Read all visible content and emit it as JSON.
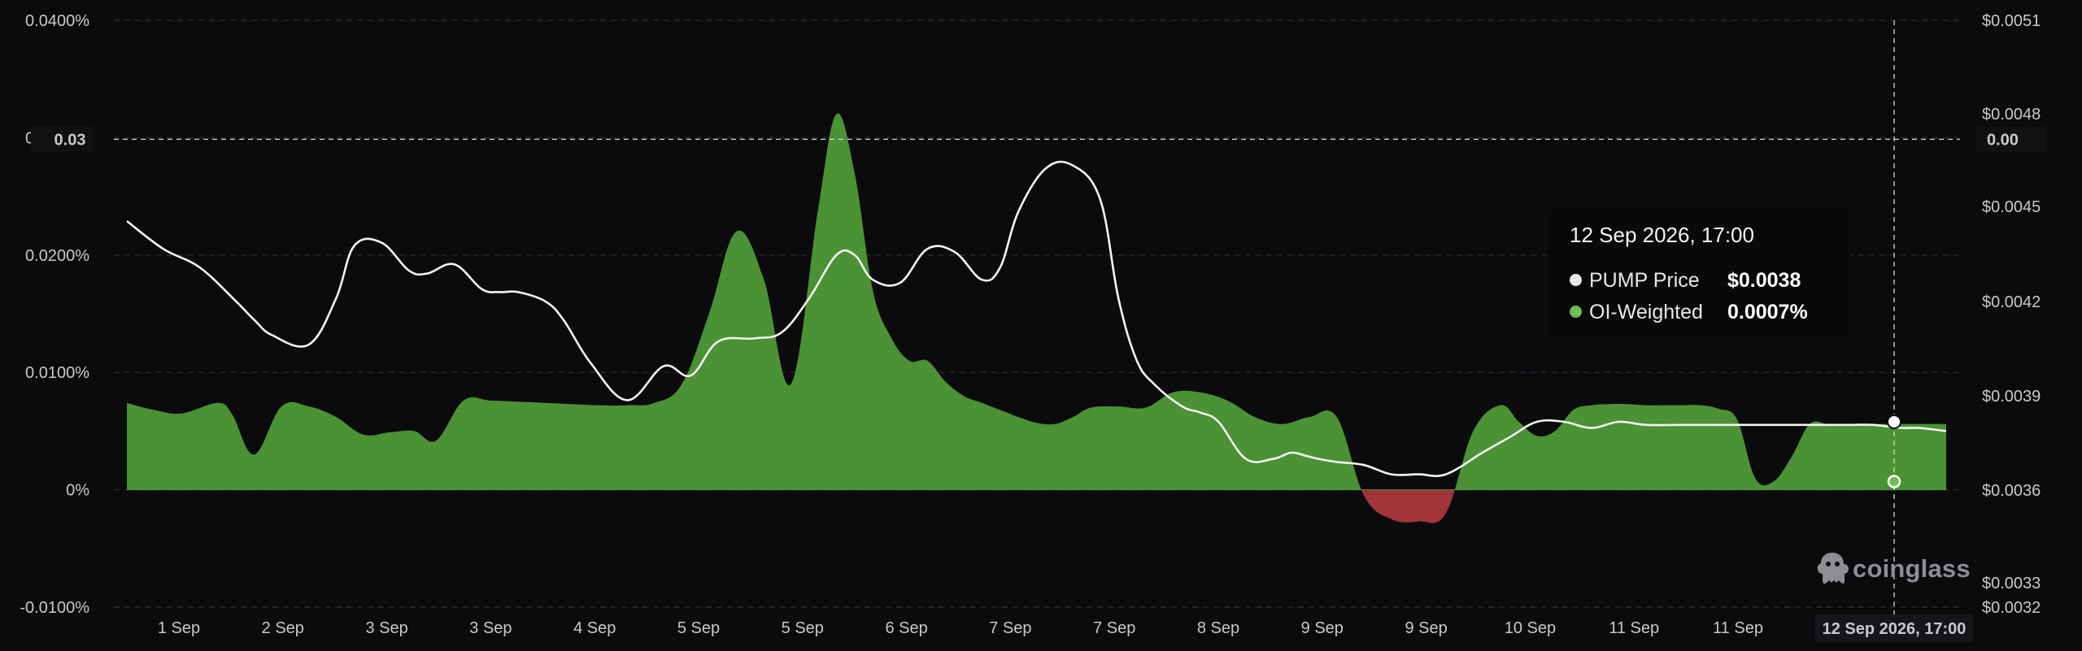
{
  "chart_data": {
    "type": "area",
    "y_left": {
      "range": [
        -0.0001,
        0.0004
      ],
      "ticks": [
        "-0.0100%",
        "0%",
        "0.0100%",
        "0.0200%",
        "0.0300%",
        "0.0400%"
      ],
      "crosshair_label": "0.03"
    },
    "y_right": {
      "range": [
        0.0032,
        0.0051
      ],
      "ticks": [
        "$0.0032",
        "$0.0033",
        "$0.0036",
        "$0.0039",
        "$0.0042",
        "$0.0045",
        "$0.0048",
        "$0.0051"
      ],
      "crosshair_label": "0.00"
    },
    "x_ticks": [
      "1 Sep",
      "2 Sep",
      "3 Sep",
      "3 Sep",
      "4 Sep",
      "5 Sep",
      "5 Sep",
      "6 Sep",
      "7 Sep",
      "7 Sep",
      "8 Sep",
      "9 Sep",
      "9 Sep",
      "10 Sep",
      "11 Sep",
      "11 Sep"
    ],
    "x_highlight_label": "12 Sep 2026, 17:00",
    "series": [
      {
        "name": "OI-Weighted",
        "axis": "left",
        "positive_color": "#4a9234",
        "negative_color": "#a3343a",
        "x": [
          0,
          0.015,
          0.03,
          0.05,
          0.058,
          0.07,
          0.085,
          0.1,
          0.115,
          0.13,
          0.145,
          0.158,
          0.17,
          0.185,
          0.2,
          0.215,
          0.23,
          0.245,
          0.26,
          0.275,
          0.29,
          0.305,
          0.32,
          0.335,
          0.35,
          0.365,
          0.38,
          0.39,
          0.4,
          0.41,
          0.42,
          0.43,
          0.44,
          0.45,
          0.46,
          0.47,
          0.48,
          0.49,
          0.5,
          0.51,
          0.52,
          0.53,
          0.545,
          0.56,
          0.575,
          0.59,
          0.605,
          0.62,
          0.635,
          0.65,
          0.665,
          0.68,
          0.695,
          0.71,
          0.725,
          0.74,
          0.755,
          0.765,
          0.775,
          0.785,
          0.795,
          0.805,
          0.815,
          0.825,
          0.835,
          0.845,
          0.855,
          0.865,
          0.875,
          0.885,
          0.895,
          0.905,
          0.915,
          0.925,
          0.935,
          0.945,
          0.955,
          0.965,
          0.975,
          0.985,
          1.0
        ],
        "values": [
          7.4e-05,
          6.8e-05,
          6.5e-05,
          7.4e-05,
          6.4e-05,
          3e-05,
          7.1e-05,
          7.1e-05,
          6.2e-05,
          4.7e-05,
          4.9e-05,
          5e-05,
          4.2e-05,
          7.6e-05,
          7.6e-05,
          7.5e-05,
          7.4e-05,
          7.3e-05,
          7.2e-05,
          7.2e-05,
          7.4e-05,
          9e-05,
          0.00015,
          0.00022,
          0.00018,
          9e-05,
          0.00024,
          0.00032,
          0.00027,
          0.00017,
          0.00013,
          0.00011,
          0.00011,
          9.2e-05,
          8e-05,
          7.4e-05,
          6.8e-05,
          6.2e-05,
          5.7e-05,
          5.6e-05,
          6.2e-05,
          7e-05,
          7.1e-05,
          7e-05,
          8.3e-05,
          8.3e-05,
          7.6e-05,
          6.2e-05,
          5.6e-05,
          6.2e-05,
          6.2e-05,
          -5e-06,
          -2.5e-05,
          -2.7e-05,
          -2e-05,
          5e-05,
          7.2e-05,
          5.8e-05,
          4.6e-05,
          5e-05,
          6.8e-05,
          7.2e-05,
          7.3e-05,
          7.3e-05,
          7.2e-05,
          7.2e-05,
          7.2e-05,
          7.2e-05,
          6.9e-05,
          6e-05,
          1e-05,
          7e-06,
          2.8e-05,
          5.6e-05,
          5.6e-05,
          5.6e-05,
          5.6e-05,
          5.6e-05,
          5.6e-05,
          5.6e-05,
          5.6e-05
        ]
      },
      {
        "name": "PUMP Price",
        "axis": "right",
        "color": "#f4f4f4",
        "x": [
          0,
          0.02,
          0.04,
          0.06,
          0.07,
          0.08,
          0.1,
          0.115,
          0.125,
          0.14,
          0.155,
          0.165,
          0.18,
          0.195,
          0.205,
          0.215,
          0.23,
          0.24,
          0.255,
          0.275,
          0.295,
          0.31,
          0.325,
          0.345,
          0.36,
          0.375,
          0.39,
          0.4,
          0.41,
          0.425,
          0.44,
          0.455,
          0.47,
          0.48,
          0.49,
          0.505,
          0.52,
          0.535,
          0.545,
          0.555,
          0.565,
          0.58,
          0.59,
          0.6,
          0.615,
          0.63,
          0.64,
          0.648,
          0.655,
          0.665,
          0.68,
          0.695,
          0.71,
          0.725,
          0.745,
          0.76,
          0.775,
          0.79,
          0.805,
          0.82,
          0.835,
          0.855,
          0.87,
          0.885,
          0.9,
          0.915,
          0.93,
          0.945,
          0.96,
          0.975,
          0.985,
          1.0
        ],
        "values": [
          0.00445,
          0.00436,
          0.0043,
          0.00419,
          0.00413,
          0.00408,
          0.00405,
          0.0042,
          0.00437,
          0.00438,
          0.00429,
          0.00428,
          0.00431,
          0.00423,
          0.00422,
          0.00422,
          0.00419,
          0.00413,
          0.00399,
          0.00387,
          0.00398,
          0.00395,
          0.00406,
          0.00407,
          0.00409,
          0.0042,
          0.00434,
          0.00434,
          0.00426,
          0.00425,
          0.00436,
          0.00435,
          0.00426,
          0.0043,
          0.00448,
          0.00462,
          0.00463,
          0.00452,
          0.0042,
          0.004,
          0.00392,
          0.00385,
          0.00383,
          0.0038,
          0.00368,
          0.00368,
          0.0037,
          0.00369,
          0.00368,
          0.00367,
          0.00366,
          0.00363,
          0.00363,
          0.00363,
          0.0037,
          0.00375,
          0.0038,
          0.0038,
          0.00378,
          0.0038,
          0.00379,
          0.00379,
          0.00379,
          0.00379,
          0.00379,
          0.00379,
          0.00379,
          0.00379,
          0.00379,
          0.00378,
          0.00378,
          0.00377
        ]
      }
    ],
    "tooltip": {
      "title": "12 Sep 2026, 17:00",
      "rows": [
        {
          "label": "PUMP Price",
          "value": "$0.0038",
          "dot_color": "#e8e8e8"
        },
        {
          "label": "OI-Weighted",
          "value": "0.0007%",
          "dot_color": "#6fbf52"
        }
      ]
    },
    "grid": true,
    "legend": "none"
  },
  "brand": {
    "name": "coinglass"
  }
}
